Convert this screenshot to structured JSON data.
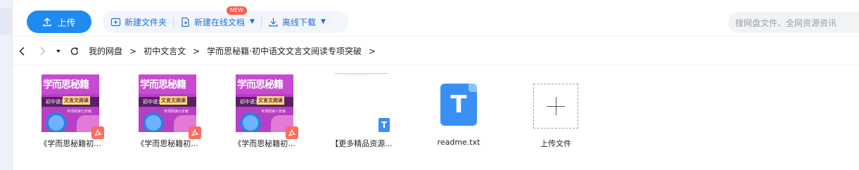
{
  "toolbar": {
    "upload_label": "上传",
    "new_folder_label": "新建文件夹",
    "new_online_doc_label": "新建在线文档",
    "new_badge": "NEW",
    "offline_download_label": "离线下载",
    "search_placeholder": "搜网盘文件、全网资源资讯",
    "accent_color": "#1f8af0"
  },
  "breadcrumb": {
    "items": [
      "我的网盘",
      "初中文言文",
      "学而思秘籍·初中语文文言文阅读专项突破"
    ],
    "separator": ">"
  },
  "cover": {
    "title": "学而思秘籍",
    "subject": "初中语文",
    "series": "文言文阅读"
  },
  "files": [
    {
      "name": "《学而思秘籍初...",
      "type": "pdf",
      "grade": "专项阅读七年级"
    },
    {
      "name": "《学而思秘籍初...",
      "type": "pdf",
      "grade": "专项阅读九年级"
    },
    {
      "name": "《学而思秘籍初...",
      "type": "pdf",
      "grade": "专项阅读八年级"
    },
    {
      "name": "【更多精品资源...",
      "type": "doc"
    },
    {
      "name": "readme.txt",
      "type": "txt"
    },
    {
      "name": "上传文件",
      "type": "upload"
    }
  ]
}
